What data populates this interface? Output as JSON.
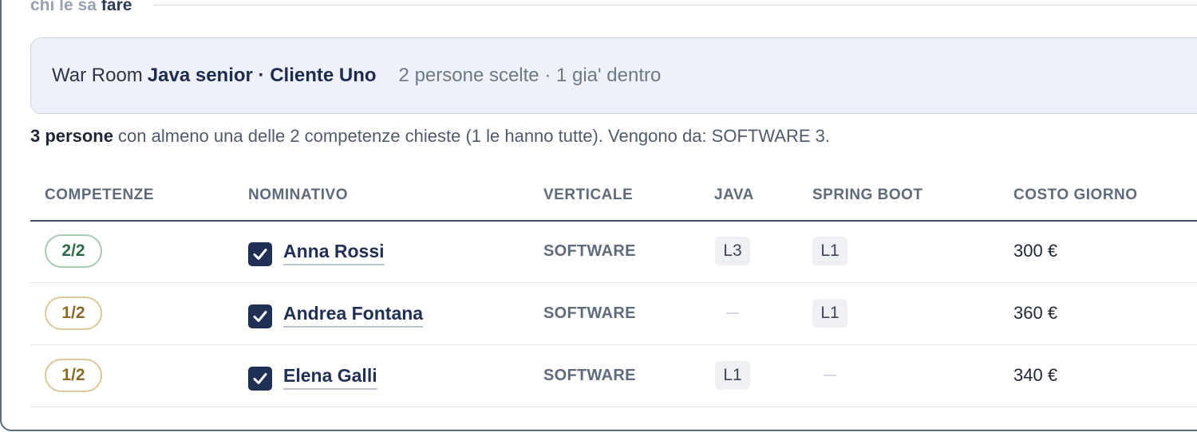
{
  "section": {
    "label_muted": "chi le sa",
    "label_strong": "fare"
  },
  "banner": {
    "prefix": "War Room",
    "title": "Java senior · Cliente Uno",
    "meta": "2 persone scelte · 1 gia' dentro"
  },
  "summary": {
    "bold": "3 persone",
    "rest": " con almeno una delle 2 competenze chieste (1 le hanno tutte). Vengono da: SOFTWARE 3."
  },
  "table": {
    "headers": {
      "competenze": "COMPETENZE",
      "nominativo": "NOMINATIVO",
      "verticale": "VERTICALE",
      "java": "JAVA",
      "spring": "SPRING BOOT",
      "costo": "COSTO GIORNO"
    },
    "rows": [
      {
        "match": "2/2",
        "match_status": "full",
        "checked": true,
        "name": "Anna Rossi",
        "verticale": "SOFTWARE",
        "java": "L3",
        "spring": "L1",
        "cost": "300 €"
      },
      {
        "match": "1/2",
        "match_status": "partial",
        "checked": true,
        "name": "Andrea Fontana",
        "verticale": "SOFTWARE",
        "java": null,
        "spring": "L1",
        "cost": "360 €"
      },
      {
        "match": "1/2",
        "match_status": "partial",
        "checked": true,
        "name": "Elena Galli",
        "verticale": "SOFTWARE",
        "java": "L1",
        "spring": null,
        "cost": "340 €"
      }
    ]
  },
  "icons": {
    "checkbox": "checkmark-icon",
    "empty_level": "dash-icon"
  },
  "colors": {
    "accent": "#1f2f55",
    "match_full": "#2c6b48",
    "match_partial": "#8a6b27"
  }
}
